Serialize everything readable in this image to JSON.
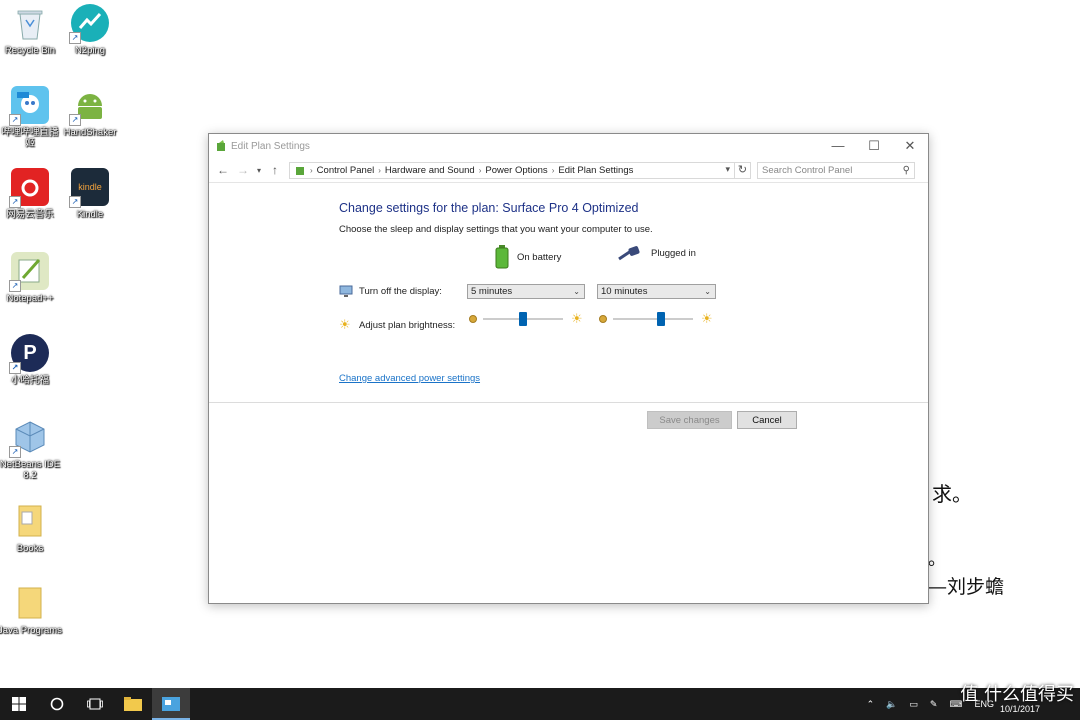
{
  "desktop": {
    "icons": [
      {
        "label": "Recycle Bin"
      },
      {
        "label": "N2ping"
      },
      {
        "label": "哔哩哔哩直播姬"
      },
      {
        "label": "HandShaker"
      },
      {
        "label": "网易云音乐"
      },
      {
        "label": "Kindle"
      },
      {
        "label": "Notepad++"
      },
      {
        "label": "小哈托福"
      },
      {
        "label": "NetBeans IDE 8.2"
      },
      {
        "label": "Books"
      },
      {
        "label": "Java Programs"
      }
    ],
    "background_text": {
      "line1": "求。",
      "line2": "。",
      "line3": "—刘步蟾"
    }
  },
  "window": {
    "title": "Edit Plan Settings",
    "breadcrumb": [
      "Control Panel",
      "Hardware and Sound",
      "Power Options",
      "Edit Plan Settings"
    ],
    "search_placeholder": "Search Control Panel",
    "heading": "Change settings for the plan: Surface Pro 4 Optimized",
    "subtext": "Choose the sleep and display settings that you want your computer to use.",
    "columns": {
      "battery": "On battery",
      "plugged": "Plugged in"
    },
    "display_label": "Turn off the display:",
    "display_battery": "5 minutes",
    "display_plugged": "10 minutes",
    "brightness_label": "Adjust plan brightness:",
    "brightness_battery": 0.5,
    "brightness_plugged": 0.6,
    "advanced_link": "Change advanced power settings",
    "save_button": "Save changes",
    "cancel_button": "Cancel"
  },
  "taskbar": {
    "language": "ENG",
    "date": "10/1/2017"
  },
  "watermark": "值 什么值得买",
  "colors": {
    "accent": "#0063b1",
    "heading": "#1e3287",
    "link": "#1a73c8"
  }
}
